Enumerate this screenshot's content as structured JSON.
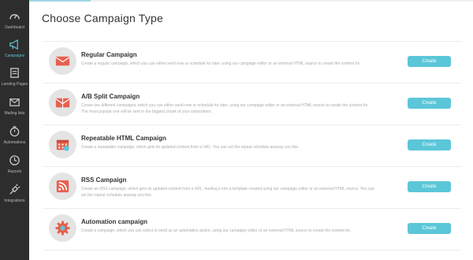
{
  "sidebar": {
    "items": [
      {
        "label": "Dashboard",
        "icon": "dashboard-icon",
        "active": false
      },
      {
        "label": "Campaigns",
        "icon": "megaphone-icon",
        "active": true
      },
      {
        "label": "Landing Pages",
        "icon": "landing-page-icon",
        "active": false
      },
      {
        "label": "Mailing lists",
        "icon": "mailing-list-icon",
        "active": false
      },
      {
        "label": "Automations",
        "icon": "stopwatch-icon",
        "active": false
      },
      {
        "label": "Reports",
        "icon": "clock-icon",
        "active": false
      },
      {
        "label": "Integrations",
        "icon": "plug-icon",
        "active": false
      }
    ]
  },
  "colors": {
    "sidebar_bg": "#2d2d2d",
    "accent": "#5cc6d9",
    "icon_red": "#e8604d"
  },
  "page": {
    "title": "Choose Campaign Type"
  },
  "campaigns": [
    {
      "title": "Regular Campaign",
      "description": "Create a regular campaign, which you can either send now or schedule for later, using our campaign editor or an external HTML source to create the content for.",
      "button": "Create",
      "icon": "envelope-icon"
    },
    {
      "title": "A/B Split Campaign",
      "description": "Create two different campaigns, which you can either send now or schedule for later, using our campaign editor or an external HTML source to create the content for. The most popular one will be sent to the biggest chunk of your subscribers.",
      "button": "Create",
      "icon": "split-envelope-icon"
    },
    {
      "title": "Repeatable HTML Campaign",
      "description": "Create a repeatable campaign, which gets its updated content from a URL. You can set the repeat schedule anyway you like.",
      "button": "Create",
      "icon": "calendar-icon"
    },
    {
      "title": "RSS Campaign",
      "description": "Create an RSS campaign, which gets its updated content from a URL, feeding it into a template created using our campaign editor or an external HTML source. You can set the repeat schedule anyway you like.",
      "button": "Create",
      "icon": "rss-icon"
    },
    {
      "title": "Automation campaign",
      "description": "Create a campaign, which you can select to send as an automation action, using our campaign editor or an external HTML source to create the content for.",
      "button": "Create",
      "icon": "gear-icon"
    }
  ]
}
